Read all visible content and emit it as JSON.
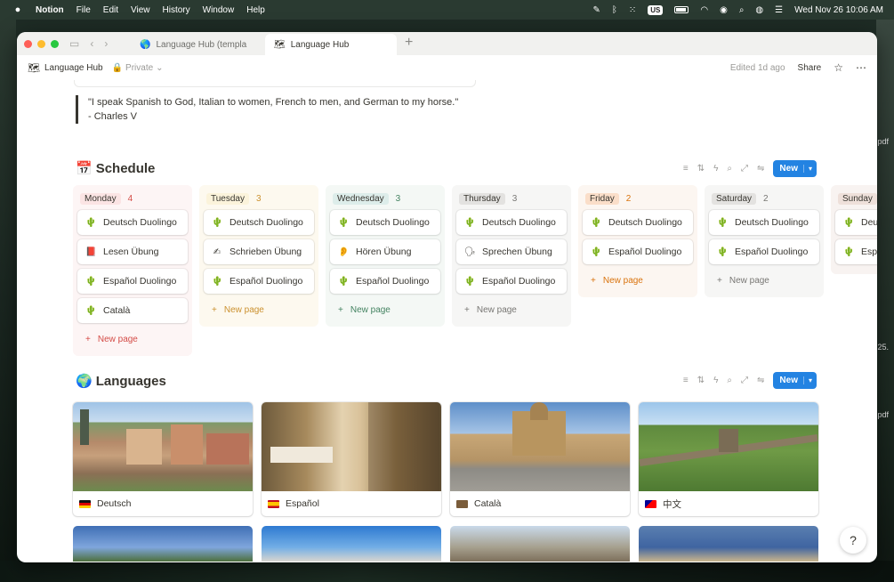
{
  "menubar": {
    "app": "Notion",
    "items": [
      "File",
      "Edit",
      "View",
      "History",
      "Window",
      "Help"
    ],
    "keyboard": "US",
    "datetime": "Wed Nov 26  10:06 AM"
  },
  "tabs": [
    {
      "label": "Language Hub (templa",
      "icon": "globe-icon"
    },
    {
      "label": "Language Hub",
      "icon": "map-icon"
    }
  ],
  "topbar": {
    "breadcrumb": "Language Hub",
    "privacy": "Private",
    "edited": "Edited 1d ago",
    "share": "Share"
  },
  "quote": {
    "line1": "\"I speak Spanish to God, Italian to women, French to men, and German to my horse.\"",
    "line2": "- Charles V"
  },
  "schedule": {
    "title": "Schedule",
    "icon": "📅",
    "new_label": "New",
    "new_page": "New page",
    "columns": [
      {
        "day": "Monday",
        "count": "4",
        "pill_bg": "#fbe4e4",
        "col_bg": "#fdf5f5",
        "count_color": "#d44c47",
        "cards": [
          {
            "icon": "🌵",
            "label": "Deutsch Duolingo"
          },
          {
            "icon": "📕",
            "label": "Lesen Übung"
          },
          {
            "icon": "🌵",
            "label": "Español Duolingo"
          },
          {
            "icon": "🌵",
            "label": "Català"
          }
        ]
      },
      {
        "day": "Tuesday",
        "count": "3",
        "pill_bg": "#fbf3db",
        "col_bg": "#fdf9ef",
        "count_color": "#cb912f",
        "cards": [
          {
            "icon": "🌵",
            "label": "Deutsch Duolingo"
          },
          {
            "icon": "✍",
            "label": "Schrieben Übung"
          },
          {
            "icon": "🌵",
            "label": "Español Duolingo"
          }
        ]
      },
      {
        "day": "Wednesday",
        "count": "3",
        "pill_bg": "#ddedea",
        "col_bg": "#f4f8f5",
        "count_color": "#448361",
        "cards": [
          {
            "icon": "🌵",
            "label": "Deutsch Duolingo"
          },
          {
            "icon": "👂",
            "label": "Hören Übung"
          },
          {
            "icon": "🌵",
            "label": "Español Duolingo"
          }
        ]
      },
      {
        "day": "Thursday",
        "count": "3",
        "pill_bg": "#e3e2e0",
        "col_bg": "#f6f6f5",
        "count_color": "#787774",
        "cards": [
          {
            "icon": "🌵",
            "label": "Deutsch Duolingo"
          },
          {
            "icon": "🗣",
            "label": "Sprechen Übung"
          },
          {
            "icon": "🌵",
            "label": "Español Duolingo"
          }
        ]
      },
      {
        "day": "Friday",
        "count": "2",
        "pill_bg": "#fadec9",
        "col_bg": "#fcf6f1",
        "count_color": "#d9730d",
        "cards": [
          {
            "icon": "🌵",
            "label": "Deutsch Duolingo"
          },
          {
            "icon": "🌵",
            "label": "Español Duolingo"
          }
        ]
      },
      {
        "day": "Saturday",
        "count": "2",
        "pill_bg": "#e3e2e0",
        "col_bg": "#f6f6f5",
        "count_color": "#787774",
        "cards": [
          {
            "icon": "🌵",
            "label": "Deutsch Duolingo"
          },
          {
            "icon": "🌵",
            "label": "Español Duolingo"
          }
        ]
      },
      {
        "day": "Sunday",
        "count": "",
        "pill_bg": "#eee0da",
        "col_bg": "#f8f3f1",
        "count_color": "#9f6b53",
        "cards": [
          {
            "icon": "🌵",
            "label": "Deutsch Duolingo"
          },
          {
            "icon": "🌵",
            "label": "Español Duolingo"
          }
        ]
      }
    ]
  },
  "languages": {
    "title": "Languages",
    "icon": "🌍",
    "new_label": "New",
    "cards": [
      {
        "label": "Deutsch",
        "flag": "de-flag"
      },
      {
        "label": "Español",
        "flag": "es-flag"
      },
      {
        "label": "Català",
        "flag": "ca-flag"
      },
      {
        "label": "中文",
        "flag": "tw-flag"
      }
    ]
  },
  "desktop": {
    "labels": [
      "pdf",
      "25.",
      "pdf"
    ]
  }
}
